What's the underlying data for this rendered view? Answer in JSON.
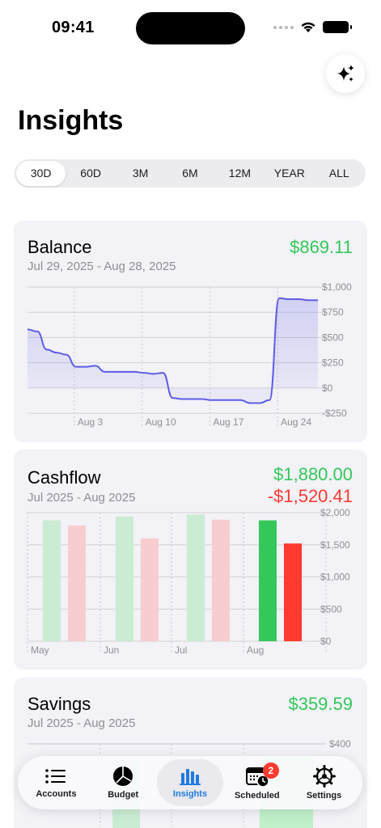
{
  "status": {
    "time": "09:41"
  },
  "header": {
    "title": "Insights",
    "sparkle_icon": "sparkles-icon"
  },
  "ranges": [
    "30D",
    "60D",
    "3M",
    "6M",
    "12M",
    "YEAR",
    "ALL"
  ],
  "selected_range": "30D",
  "balance": {
    "title": "Balance",
    "amount": "$869.11",
    "subtitle": "Jul 29, 2025 - Aug 28, 2025",
    "y_ticks": [
      "$1,000",
      "$750",
      "$500",
      "$250",
      "$0",
      "-$250"
    ],
    "x_ticks": [
      "Aug 3",
      "Aug 10",
      "Aug 17",
      "Aug 24"
    ]
  },
  "cashflow": {
    "title": "Cashflow",
    "income": "$1,880.00",
    "expense": "-$1,520.41",
    "subtitle": "Jul 2025 - Aug 2025",
    "y_ticks": [
      "$2,000",
      "$1,500",
      "$1,000",
      "$500",
      "$0"
    ],
    "x_ticks": [
      "May",
      "Jun",
      "Jul",
      "Aug"
    ]
  },
  "savings": {
    "title": "Savings",
    "amount": "$359.59",
    "subtitle": "Jul 2025 - Aug 2025",
    "y_ticks": [
      "$400"
    ]
  },
  "tabs": [
    {
      "label": "Accounts",
      "icon": "list-icon"
    },
    {
      "label": "Budget",
      "icon": "pie-chart-icon"
    },
    {
      "label": "Insights",
      "icon": "bar-chart-icon"
    },
    {
      "label": "Scheduled",
      "icon": "calendar-clock-icon",
      "badge": "2"
    },
    {
      "label": "Settings",
      "icon": "gear-icon"
    }
  ],
  "colors": {
    "accent": "#1f7ae0",
    "income": "#34c759",
    "expense": "#ff3b30",
    "balance_line": "#5e5ce6"
  },
  "chart_data": [
    {
      "type": "area",
      "title": "Balance",
      "x": [
        "Jul 29",
        "Jul 30",
        "Jul 31",
        "Aug 1",
        "Aug 2",
        "Aug 3",
        "Aug 4",
        "Aug 5",
        "Aug 6",
        "Aug 7",
        "Aug 8",
        "Aug 9",
        "Aug 10",
        "Aug 11",
        "Aug 12",
        "Aug 13",
        "Aug 14",
        "Aug 15",
        "Aug 16",
        "Aug 17",
        "Aug 18",
        "Aug 19",
        "Aug 20",
        "Aug 21",
        "Aug 22",
        "Aug 23",
        "Aug 24",
        "Aug 25",
        "Aug 26",
        "Aug 27",
        "Aug 28"
      ],
      "values": [
        580,
        560,
        380,
        350,
        330,
        210,
        210,
        220,
        160,
        160,
        160,
        160,
        150,
        140,
        150,
        -100,
        -110,
        -110,
        -110,
        -120,
        -120,
        -120,
        -120,
        -150,
        -150,
        -120,
        890,
        880,
        880,
        870,
        869.11
      ],
      "ylim": [
        -250,
        1000
      ]
    },
    {
      "type": "bar",
      "title": "Cashflow",
      "categories": [
        "May",
        "Jun",
        "Jul",
        "Aug"
      ],
      "series": [
        {
          "values": [
            1880,
            1940,
            1970,
            1880
          ]
        },
        {
          "values": [
            1800,
            1600,
            1890,
            1520.41
          ]
        }
      ],
      "ylim": [
        0,
        2000
      ]
    }
  ]
}
